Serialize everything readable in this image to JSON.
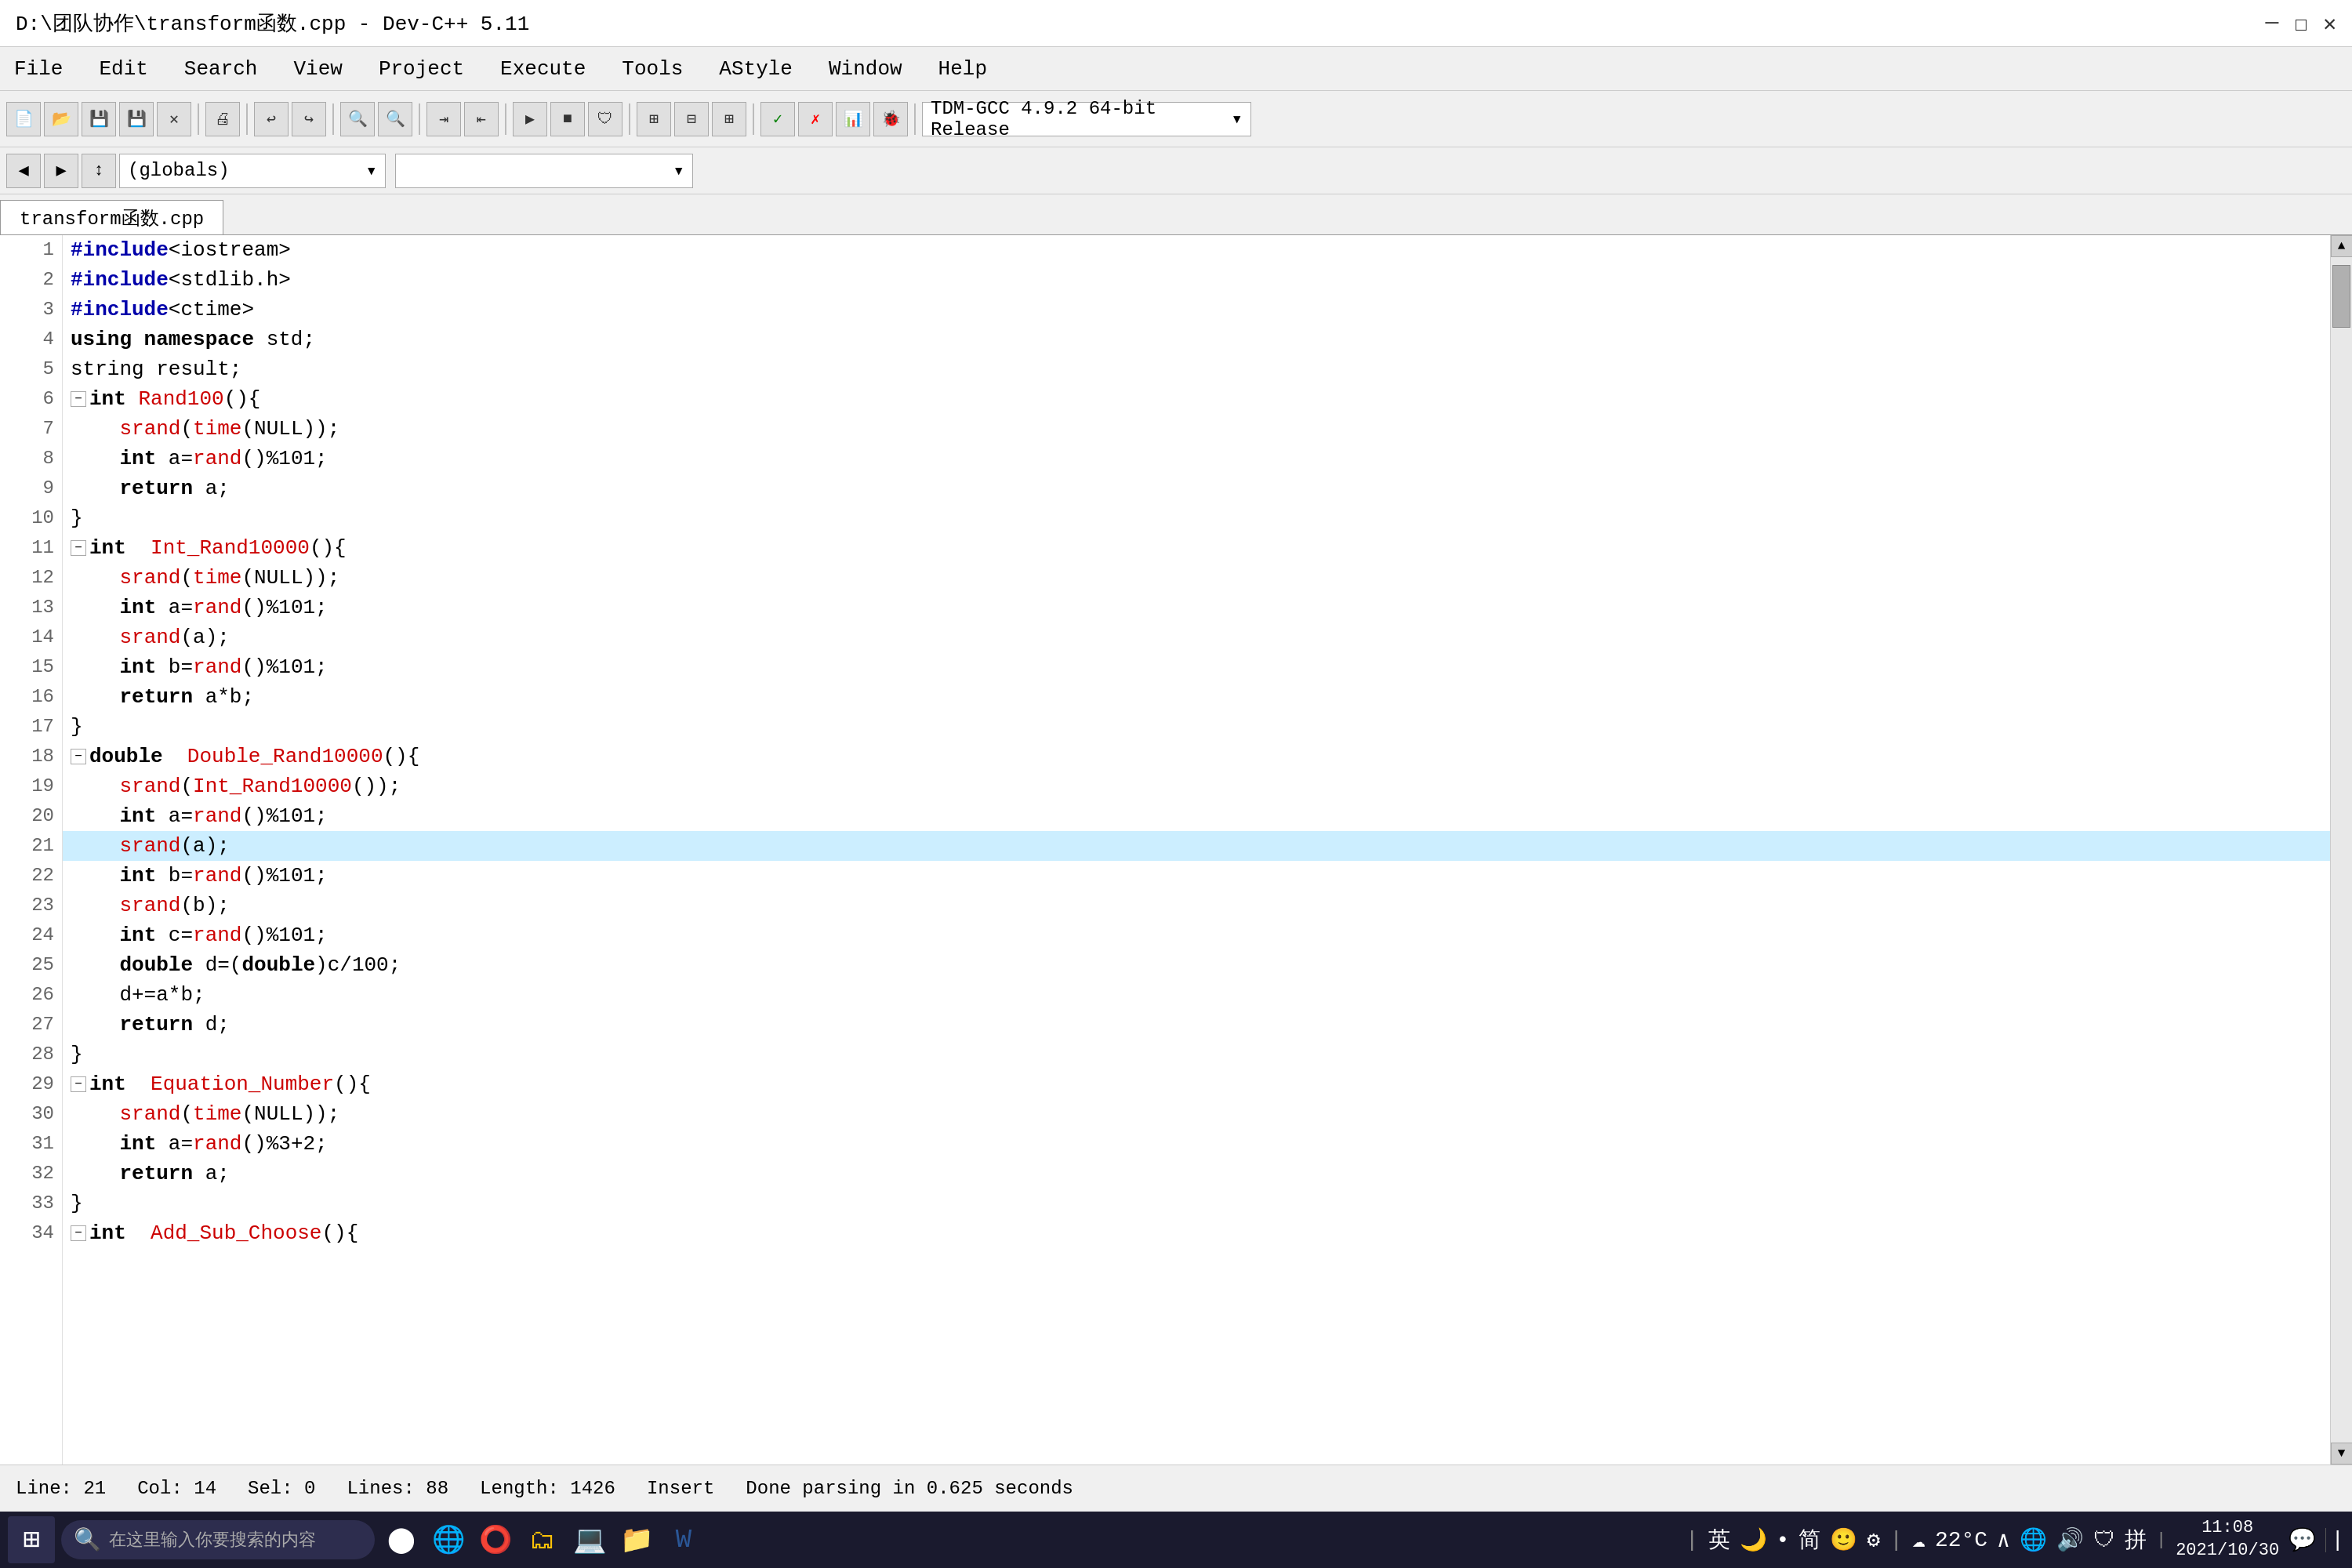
{
  "titleBar": {
    "title": "D:\\团队协作\\transform函数.cpp - Dev-C++ 5.11",
    "minimizeLabel": "—",
    "maximizeLabel": "☐",
    "closeLabel": "✕"
  },
  "menuBar": {
    "items": [
      "File",
      "Edit",
      "Search",
      "View",
      "Project",
      "Execute",
      "Tools",
      "AStyle",
      "Window",
      "Help"
    ]
  },
  "toolbar": {
    "compiler": "TDM-GCC 4.9.2 64-bit Release",
    "chevron": "▾"
  },
  "toolbar2": {
    "scope1": "(globals)",
    "scope2": "",
    "chevron": "▾"
  },
  "tab": {
    "label": "transform函数.cpp"
  },
  "code": {
    "lines": [
      {
        "num": 1,
        "text": "#include<iostream>",
        "type": "pp"
      },
      {
        "num": 2,
        "text": "#include<stdlib.h>",
        "type": "pp"
      },
      {
        "num": 3,
        "text": "#include<ctime>",
        "type": "pp"
      },
      {
        "num": 4,
        "text": "using namespace std;",
        "type": "normal"
      },
      {
        "num": 5,
        "text": "string result;",
        "type": "normal"
      },
      {
        "num": 6,
        "text": "int Rand100(){",
        "type": "fn",
        "fold": true
      },
      {
        "num": 7,
        "text": "    srand(time(NULL));",
        "type": "normal"
      },
      {
        "num": 8,
        "text": "    int a=rand()%101;",
        "type": "normal"
      },
      {
        "num": 9,
        "text": "    return a;",
        "type": "normal"
      },
      {
        "num": 10,
        "text": "}",
        "type": "normal"
      },
      {
        "num": 11,
        "text": "int  Int_Rand10000(){",
        "type": "fn",
        "fold": true
      },
      {
        "num": 12,
        "text": "    srand(time(NULL));",
        "type": "normal"
      },
      {
        "num": 13,
        "text": "    int a=rand()%101;",
        "type": "normal"
      },
      {
        "num": 14,
        "text": "    srand(a);",
        "type": "normal"
      },
      {
        "num": 15,
        "text": "    int b=rand()%101;",
        "type": "normal"
      },
      {
        "num": 16,
        "text": "    return a*b;",
        "type": "normal"
      },
      {
        "num": 17,
        "text": "}",
        "type": "normal"
      },
      {
        "num": 18,
        "text": "double  Double_Rand10000(){",
        "type": "fn",
        "fold": true
      },
      {
        "num": 19,
        "text": "    srand(Int_Rand10000());",
        "type": "normal"
      },
      {
        "num": 20,
        "text": "    int a=rand()%101;",
        "type": "normal"
      },
      {
        "num": 21,
        "text": "    srand(a);",
        "type": "normal",
        "highlight": true
      },
      {
        "num": 22,
        "text": "    int b=rand()%101;",
        "type": "normal"
      },
      {
        "num": 23,
        "text": "    srand(b);",
        "type": "normal"
      },
      {
        "num": 24,
        "text": "    int c=rand()%101;",
        "type": "normal"
      },
      {
        "num": 25,
        "text": "    double d=(double)c/100;",
        "type": "normal"
      },
      {
        "num": 26,
        "text": "    d+=a*b;",
        "type": "normal"
      },
      {
        "num": 27,
        "text": "    return d;",
        "type": "normal"
      },
      {
        "num": 28,
        "text": "}",
        "type": "normal"
      },
      {
        "num": 29,
        "text": "int  Equation_Number(){",
        "type": "fn",
        "fold": true
      },
      {
        "num": 30,
        "text": "    srand(time(NULL));",
        "type": "normal"
      },
      {
        "num": 31,
        "text": "    int a=rand()%3+2;",
        "type": "normal"
      },
      {
        "num": 32,
        "text": "    return a;",
        "type": "normal"
      },
      {
        "num": 33,
        "text": "}",
        "type": "normal"
      },
      {
        "num": 34,
        "text": "int  Add_Sub_Choose(){",
        "type": "fn",
        "fold": true
      }
    ]
  },
  "statusBar": {
    "line": "Line: 21",
    "col": "Col: 14",
    "sel": "Sel: 0",
    "lines": "Lines: 88",
    "length": "Length: 1426",
    "mode": "Insert",
    "message": "Done parsing in 0.625 seconds"
  },
  "taskbar": {
    "searchPlaceholder": "在这里输入你要搜索的内容",
    "time": "11:08",
    "date": "2021/10/30",
    "weatherTemp": "22°C",
    "language": "英",
    "inputMethod": "拼",
    "startIcon": "⊞"
  }
}
